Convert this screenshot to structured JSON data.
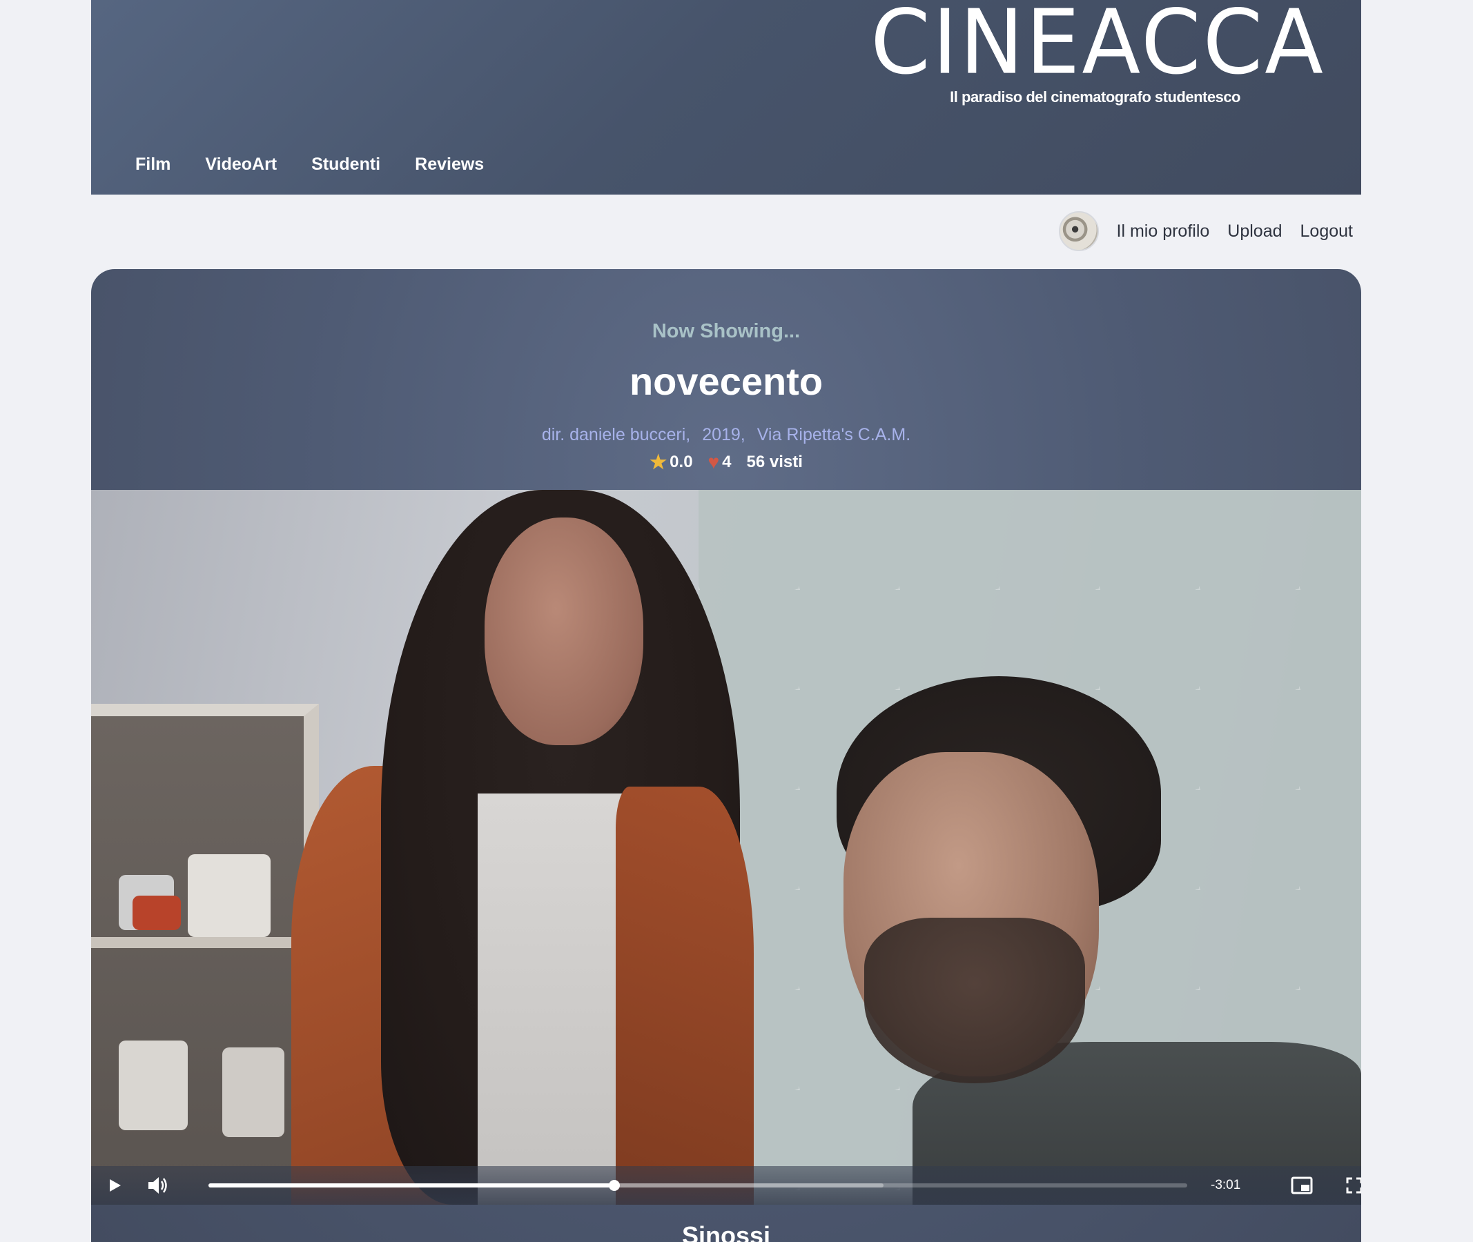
{
  "header": {
    "logo": "CINEACCA",
    "tagline": "Il paradiso del cinematografo studentesco",
    "nav": [
      "Film",
      "VideoArt",
      "Studenti",
      "Reviews"
    ]
  },
  "user_bar": {
    "profile_label": "Il mio profilo",
    "upload_label": "Upload",
    "logout_label": "Logout"
  },
  "film": {
    "now_showing": "Now Showing...",
    "title": "novecento",
    "director": "dir. daniele bucceri,",
    "year": "2019,",
    "school": "Via Ripetta's C.A.M.",
    "rating": "0.0",
    "likes": "4",
    "views": "56 visti"
  },
  "player": {
    "time_remaining": "-3:01",
    "progress_fraction": 0.415,
    "buffered_fraction": 0.69
  },
  "synopsis": {
    "heading": "Sinossi"
  },
  "colors": {
    "header_bg": "#4b586f",
    "accent_meta": "#a7b2ea",
    "now_showing": "#a9c2c7",
    "star": "#f0b93a",
    "heart": "#d35845"
  }
}
